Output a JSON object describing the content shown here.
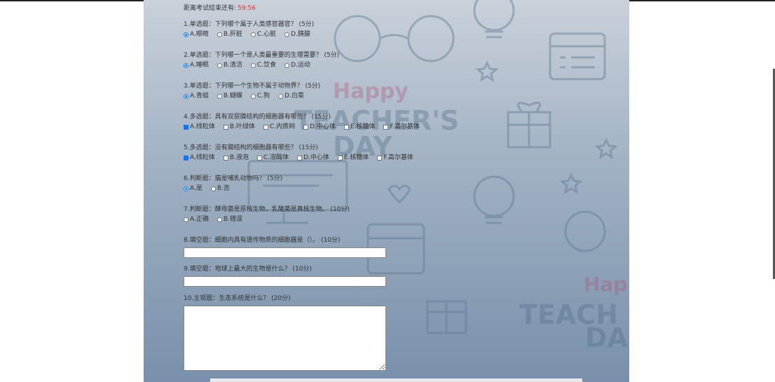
{
  "timer": {
    "label": "距离考试结束还有:",
    "value": "59:56"
  },
  "questions": [
    {
      "title": "1.单选题：下列哪个属于人类感官器官？ (5分)",
      "type": "radio",
      "options": [
        "A.眼睛",
        "B.肝脏",
        "C.心脏",
        "D.胰腺"
      ],
      "selected": [
        0
      ]
    },
    {
      "title": "2.单选题：下列哪一个是人类最重要的生理需要？ (5分)",
      "type": "radio",
      "options": [
        "A.睡眠",
        "B.清洁",
        "C.饮食",
        "D.运动"
      ],
      "selected": [
        0
      ]
    },
    {
      "title": "3.单选题：下列哪一个生物不属于动物界？ (5分)",
      "type": "radio",
      "options": [
        "A.青蛙",
        "B.蝴蝶",
        "C.狗",
        "D.白菜"
      ],
      "selected": [
        0
      ]
    },
    {
      "title": "4.多选题：具有双层膜结构的细胞器有哪些？ (15分)",
      "type": "checkbox",
      "options": [
        "A.线粒体",
        "B.叶绿体",
        "C.内质网",
        "D.中心体",
        "E.核糖体",
        "F.高尔基体"
      ],
      "selected": [
        0
      ]
    },
    {
      "title": "5.多选题：没有膜结构的细胞器有哪些？ (15分)",
      "type": "checkbox",
      "options": [
        "A.线粒体",
        "B.液泡",
        "C.溶酶体",
        "D.中心体",
        "E.核糖体",
        "F.高尔基体"
      ],
      "selected": [
        0
      ]
    },
    {
      "title": "6.判断题：猫是哺乳动物吗？ (5分)",
      "type": "radio",
      "options": [
        "A.是",
        "B.否"
      ],
      "selected": [
        0
      ]
    },
    {
      "title": "7.判断题：酵母菌是原核生物，乳酸菌是真核生物。 (10分)",
      "type": "radio",
      "options": [
        "A.正确",
        "B.错误"
      ],
      "selected": []
    },
    {
      "title": "8.填空题：细胞内具有遗传物质的细胞器是（）。 (10分)",
      "type": "text",
      "value": ""
    },
    {
      "title": "9.填空题：地球上最大的生物是什么？ (10分)",
      "type": "text",
      "value": ""
    },
    {
      "title": "10.主观题：生态系统是什么？ (20分)",
      "type": "textarea",
      "value": ""
    }
  ],
  "background": {
    "text_1": "Happy",
    "text_2": "TEACHER'S",
    "text_3": "DAY",
    "text_4": "Hap",
    "text_5": "TEACH",
    "text_6": "DA"
  },
  "colors": {
    "timer_value": "#e03030",
    "checked": "#1a73e8",
    "background_top": "#c9d1da",
    "background_bottom": "#7890ab"
  },
  "icons": [
    "glasses-icon",
    "lightbulb-icon",
    "calendar-icon",
    "gift-icon",
    "monitor-icon",
    "heart-icon",
    "star-icon"
  ]
}
